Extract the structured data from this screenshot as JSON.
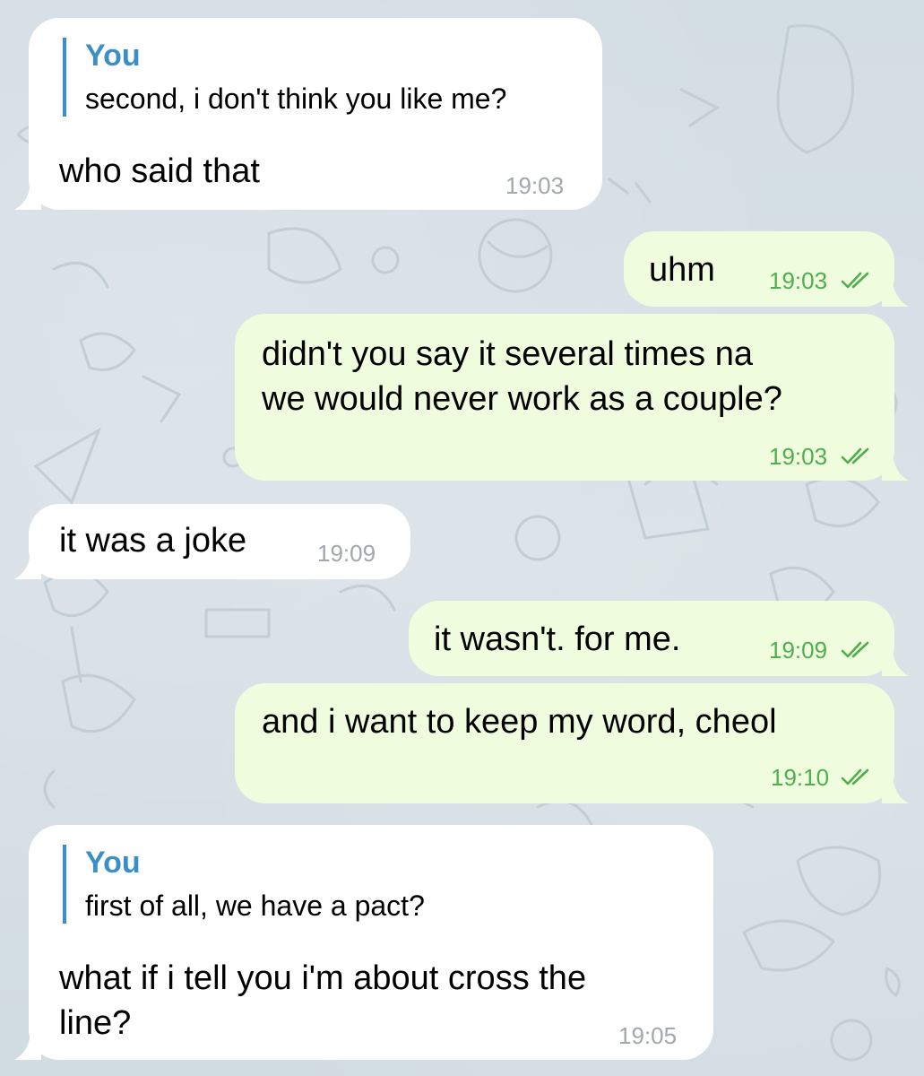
{
  "chat": {
    "messages": [
      {
        "direction": "incoming",
        "reply": {
          "author": "You",
          "text": "second, i don't think you like me?"
        },
        "text": "who said that",
        "time": "19:03"
      },
      {
        "direction": "outgoing",
        "text": "uhm",
        "time": "19:03",
        "status_icon": "double-check-icon"
      },
      {
        "direction": "outgoing",
        "lines": [
          "didn't you say it several times na",
          "we would never work as a couple?"
        ],
        "time": "19:03",
        "status_icon": "double-check-icon"
      },
      {
        "direction": "incoming",
        "text": "it was a joke",
        "time": "19:09"
      },
      {
        "direction": "outgoing",
        "text": "it wasn't. for me.",
        "time": "19:09",
        "status_icon": "double-check-icon"
      },
      {
        "direction": "outgoing",
        "text": "and i want to keep my word, cheol",
        "time": "19:10",
        "status_icon": "double-check-icon"
      },
      {
        "direction": "incoming",
        "reply": {
          "author": "You",
          "text": "first of all, we have a pact?"
        },
        "lines": [
          "what if i tell you i'm about cross the",
          "line?"
        ],
        "time": "19:05"
      }
    ]
  },
  "colors": {
    "incoming_bubble": "#ffffff",
    "outgoing_bubble": "#effdde",
    "reply_accent": "#3a8fc7",
    "outgoing_time": "#4fae4e",
    "incoming_time": "#a0a7ad",
    "wallpaper": "#d5dee5"
  },
  "wallpaper_pattern": "doodle-pets-pattern"
}
